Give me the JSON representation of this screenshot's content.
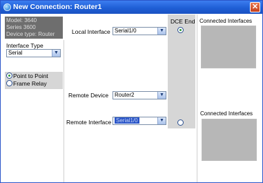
{
  "window": {
    "title": "New Connection: Router1",
    "close_symbol": "✕"
  },
  "device_info": {
    "model": "Model: 3640",
    "series": "Series 3600",
    "device_type": "Device type: Router"
  },
  "interface_type": {
    "label": "Interface Type",
    "selected": "Serial"
  },
  "connection_type": {
    "options": [
      "Point to Point",
      "Frame Relay"
    ],
    "selected": "Point to Point"
  },
  "local_interface": {
    "label": "Local Interface",
    "selected": "Serial1/0"
  },
  "remote_device": {
    "label": "Remote Device",
    "selected": "Router2"
  },
  "remote_interface": {
    "label": "Remote Interface",
    "selected": "Serial1/0"
  },
  "dce_end": {
    "label": "DCE End",
    "local_selected": true,
    "remote_selected": false
  },
  "connected_interfaces": {
    "local_label": "Connected Interfaces",
    "remote_label": "Connected Interfaces"
  },
  "icons": {
    "dropdown": "▼"
  },
  "colors": {
    "titlebar": "#1f5fd6",
    "close_button": "#d9532c",
    "device_info_bg": "#6e6e6e",
    "panel_gray": "#d6d6d6",
    "list_box": "#b7b7b7",
    "selection": "#2a55c8"
  }
}
